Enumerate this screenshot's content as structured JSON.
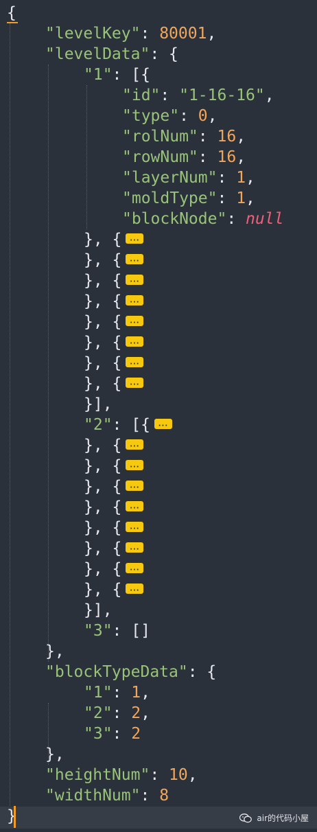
{
  "editor": {
    "lines": [
      {
        "indent": 0,
        "tokens": [
          {
            "t": "p",
            "v": "{"
          }
        ]
      },
      {
        "indent": 1,
        "tokens": [
          {
            "t": "k",
            "v": "\"levelKey\""
          },
          {
            "t": "p",
            "v": ": "
          },
          {
            "t": "n",
            "v": "80001"
          },
          {
            "t": "p",
            "v": ","
          }
        ]
      },
      {
        "indent": 1,
        "tokens": [
          {
            "t": "k",
            "v": "\"levelData\""
          },
          {
            "t": "p",
            "v": ": {"
          }
        ]
      },
      {
        "indent": 2,
        "tokens": [
          {
            "t": "k",
            "v": "\"1\""
          },
          {
            "t": "p",
            "v": ": [{"
          }
        ]
      },
      {
        "indent": 3,
        "tokens": [
          {
            "t": "k",
            "v": "\"id\""
          },
          {
            "t": "p",
            "v": ": "
          },
          {
            "t": "s",
            "v": "\"1-16-16\""
          },
          {
            "t": "p",
            "v": ","
          }
        ]
      },
      {
        "indent": 3,
        "tokens": [
          {
            "t": "k",
            "v": "\"type\""
          },
          {
            "t": "p",
            "v": ": "
          },
          {
            "t": "n",
            "v": "0"
          },
          {
            "t": "p",
            "v": ","
          }
        ]
      },
      {
        "indent": 3,
        "tokens": [
          {
            "t": "k",
            "v": "\"rolNum\""
          },
          {
            "t": "p",
            "v": ": "
          },
          {
            "t": "n",
            "v": "16"
          },
          {
            "t": "p",
            "v": ","
          }
        ]
      },
      {
        "indent": 3,
        "tokens": [
          {
            "t": "k",
            "v": "\"rowNum\""
          },
          {
            "t": "p",
            "v": ": "
          },
          {
            "t": "n",
            "v": "16"
          },
          {
            "t": "p",
            "v": ","
          }
        ]
      },
      {
        "indent": 3,
        "tokens": [
          {
            "t": "k",
            "v": "\"layerNum\""
          },
          {
            "t": "p",
            "v": ": "
          },
          {
            "t": "n",
            "v": "1"
          },
          {
            "t": "p",
            "v": ","
          }
        ]
      },
      {
        "indent": 3,
        "tokens": [
          {
            "t": "k",
            "v": "\"moldType\""
          },
          {
            "t": "p",
            "v": ": "
          },
          {
            "t": "n",
            "v": "1"
          },
          {
            "t": "p",
            "v": ","
          }
        ]
      },
      {
        "indent": 3,
        "tokens": [
          {
            "t": "k",
            "v": "\"blockNode\""
          },
          {
            "t": "p",
            "v": ": "
          },
          {
            "t": "nul",
            "v": "null"
          }
        ]
      },
      {
        "indent": 2,
        "tokens": [
          {
            "t": "p",
            "v": "}, {"
          }
        ],
        "fold": true
      },
      {
        "indent": 2,
        "tokens": [
          {
            "t": "p",
            "v": "}, {"
          }
        ],
        "fold": true
      },
      {
        "indent": 2,
        "tokens": [
          {
            "t": "p",
            "v": "}, {"
          }
        ],
        "fold": true
      },
      {
        "indent": 2,
        "tokens": [
          {
            "t": "p",
            "v": "}, {"
          }
        ],
        "fold": true
      },
      {
        "indent": 2,
        "tokens": [
          {
            "t": "p",
            "v": "}, {"
          }
        ],
        "fold": true
      },
      {
        "indent": 2,
        "tokens": [
          {
            "t": "p",
            "v": "}, {"
          }
        ],
        "fold": true
      },
      {
        "indent": 2,
        "tokens": [
          {
            "t": "p",
            "v": "}, {"
          }
        ],
        "fold": true
      },
      {
        "indent": 2,
        "tokens": [
          {
            "t": "p",
            "v": "}, {"
          }
        ],
        "fold": true
      },
      {
        "indent": 2,
        "tokens": [
          {
            "t": "p",
            "v": "}],"
          }
        ]
      },
      {
        "indent": 2,
        "tokens": [
          {
            "t": "k",
            "v": "\"2\""
          },
          {
            "t": "p",
            "v": ": [{"
          }
        ],
        "fold": true
      },
      {
        "indent": 2,
        "tokens": [
          {
            "t": "p",
            "v": "}, {"
          }
        ],
        "fold": true
      },
      {
        "indent": 2,
        "tokens": [
          {
            "t": "p",
            "v": "}, {"
          }
        ],
        "fold": true
      },
      {
        "indent": 2,
        "tokens": [
          {
            "t": "p",
            "v": "}, {"
          }
        ],
        "fold": true
      },
      {
        "indent": 2,
        "tokens": [
          {
            "t": "p",
            "v": "}, {"
          }
        ],
        "fold": true
      },
      {
        "indent": 2,
        "tokens": [
          {
            "t": "p",
            "v": "}, {"
          }
        ],
        "fold": true
      },
      {
        "indent": 2,
        "tokens": [
          {
            "t": "p",
            "v": "}, {"
          }
        ],
        "fold": true
      },
      {
        "indent": 2,
        "tokens": [
          {
            "t": "p",
            "v": "}, {"
          }
        ],
        "fold": true
      },
      {
        "indent": 2,
        "tokens": [
          {
            "t": "p",
            "v": "}, {"
          }
        ],
        "fold": true
      },
      {
        "indent": 2,
        "tokens": [
          {
            "t": "p",
            "v": "}],"
          }
        ]
      },
      {
        "indent": 2,
        "tokens": [
          {
            "t": "k",
            "v": "\"3\""
          },
          {
            "t": "p",
            "v": ": []"
          }
        ]
      },
      {
        "indent": 1,
        "tokens": [
          {
            "t": "p",
            "v": "},"
          }
        ]
      },
      {
        "indent": 1,
        "tokens": [
          {
            "t": "k",
            "v": "\"blockTypeData\""
          },
          {
            "t": "p",
            "v": ": {"
          }
        ]
      },
      {
        "indent": 2,
        "tokens": [
          {
            "t": "k",
            "v": "\"1\""
          },
          {
            "t": "p",
            "v": ": "
          },
          {
            "t": "n",
            "v": "1"
          },
          {
            "t": "p",
            "v": ","
          }
        ]
      },
      {
        "indent": 2,
        "tokens": [
          {
            "t": "k",
            "v": "\"2\""
          },
          {
            "t": "p",
            "v": ": "
          },
          {
            "t": "n",
            "v": "2"
          },
          {
            "t": "p",
            "v": ","
          }
        ]
      },
      {
        "indent": 2,
        "tokens": [
          {
            "t": "k",
            "v": "\"3\""
          },
          {
            "t": "p",
            "v": ": "
          },
          {
            "t": "n",
            "v": "2"
          }
        ]
      },
      {
        "indent": 1,
        "tokens": [
          {
            "t": "p",
            "v": "},"
          }
        ]
      },
      {
        "indent": 1,
        "tokens": [
          {
            "t": "k",
            "v": "\"heightNum\""
          },
          {
            "t": "p",
            "v": ": "
          },
          {
            "t": "n",
            "v": "10"
          },
          {
            "t": "p",
            "v": ","
          }
        ]
      },
      {
        "indent": 1,
        "tokens": [
          {
            "t": "k",
            "v": "\"widthNum\""
          },
          {
            "t": "p",
            "v": ": "
          },
          {
            "t": "n",
            "v": "8"
          }
        ]
      },
      {
        "indent": 0,
        "tokens": [
          {
            "t": "p",
            "v": "}"
          }
        ]
      }
    ],
    "colors": {
      "background": "#2b313a",
      "key": "#98c379",
      "number": "#f2a65a",
      "null": "#f25f7a",
      "punctuation": "#e7e9ee",
      "fold_badge": "#f6c90e",
      "caret": "#f39c24",
      "current_line": "#373d47"
    },
    "fold_marker": "···"
  },
  "watermark": {
    "icon": "wechat-icon",
    "text": "air的代码小屋"
  }
}
